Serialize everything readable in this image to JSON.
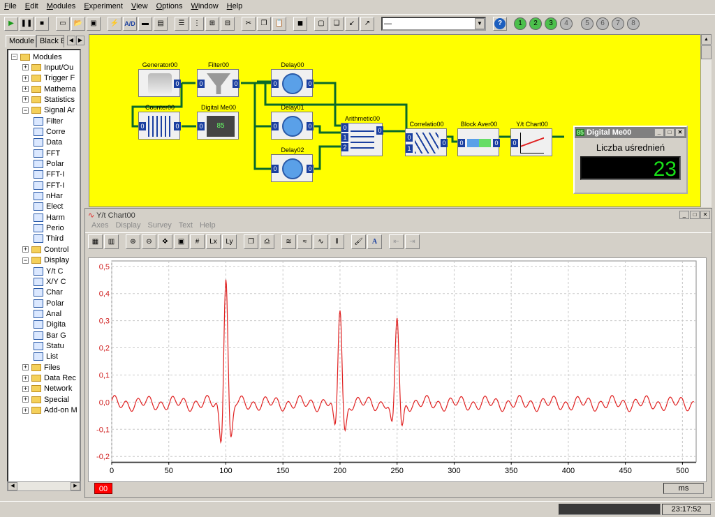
{
  "menu": [
    "File",
    "Edit",
    "Modules",
    "Experiment",
    "View",
    "Options",
    "Window",
    "Help"
  ],
  "toolbar": {
    "combo_value": "—",
    "numbers": [
      "1",
      "2",
      "3",
      "4",
      "5",
      "6",
      "7",
      "8"
    ]
  },
  "left_panel": {
    "tabs": [
      "Module",
      "Black B"
    ],
    "tree": [
      {
        "label": "Modules",
        "level": 0,
        "kind": "folder",
        "toggle": "−"
      },
      {
        "label": "Input/Ou",
        "level": 1,
        "kind": "folder",
        "toggle": "+"
      },
      {
        "label": "Trigger F",
        "level": 1,
        "kind": "folder",
        "toggle": "+"
      },
      {
        "label": "Mathema",
        "level": 1,
        "kind": "folder",
        "toggle": "+"
      },
      {
        "label": "Statistics",
        "level": 1,
        "kind": "folder",
        "toggle": "+"
      },
      {
        "label": "Signal Ar",
        "level": 1,
        "kind": "folder",
        "toggle": "−"
      },
      {
        "label": "Filter",
        "level": 2,
        "kind": "module"
      },
      {
        "label": "Corre",
        "level": 2,
        "kind": "module"
      },
      {
        "label": "Data",
        "level": 2,
        "kind": "module"
      },
      {
        "label": "FFT",
        "level": 2,
        "kind": "module"
      },
      {
        "label": "Polar",
        "level": 2,
        "kind": "module"
      },
      {
        "label": "FFT-I",
        "level": 2,
        "kind": "module"
      },
      {
        "label": "FFT-I",
        "level": 2,
        "kind": "module"
      },
      {
        "label": "nHar",
        "level": 2,
        "kind": "module"
      },
      {
        "label": "Elect",
        "level": 2,
        "kind": "module"
      },
      {
        "label": "Harm",
        "level": 2,
        "kind": "module"
      },
      {
        "label": "Perio",
        "level": 2,
        "kind": "module"
      },
      {
        "label": "Third",
        "level": 2,
        "kind": "module"
      },
      {
        "label": "Control",
        "level": 1,
        "kind": "folder",
        "toggle": "+"
      },
      {
        "label": "Display",
        "level": 1,
        "kind": "folder",
        "toggle": "−"
      },
      {
        "label": "Y/t C",
        "level": 2,
        "kind": "module"
      },
      {
        "label": "X/Y C",
        "level": 2,
        "kind": "module"
      },
      {
        "label": "Char",
        "level": 2,
        "kind": "module"
      },
      {
        "label": "Polar",
        "level": 2,
        "kind": "module"
      },
      {
        "label": "Anal",
        "level": 2,
        "kind": "module"
      },
      {
        "label": "Digita",
        "level": 2,
        "kind": "module"
      },
      {
        "label": "Bar G",
        "level": 2,
        "kind": "module"
      },
      {
        "label": "Statu",
        "level": 2,
        "kind": "module"
      },
      {
        "label": "List",
        "level": 2,
        "kind": "module"
      },
      {
        "label": "Files",
        "level": 1,
        "kind": "folder",
        "toggle": "+"
      },
      {
        "label": "Data Rec",
        "level": 1,
        "kind": "folder",
        "toggle": "+"
      },
      {
        "label": "Network",
        "level": 1,
        "kind": "folder",
        "toggle": "+"
      },
      {
        "label": "Special",
        "level": 1,
        "kind": "folder",
        "toggle": "+"
      },
      {
        "label": "Add-on M",
        "level": 1,
        "kind": "folder",
        "toggle": "+"
      }
    ]
  },
  "workspace": {
    "background": "#ffff00",
    "blocks": [
      {
        "name": "Generator00",
        "inputs": [],
        "outputs": [
          "0"
        ],
        "icon": "generator-icon"
      },
      {
        "name": "Filter00",
        "inputs": [
          "0"
        ],
        "outputs": [
          "0"
        ],
        "icon": "funnel-icon"
      },
      {
        "name": "Delay00",
        "inputs": [
          "0"
        ],
        "outputs": [
          "0"
        ],
        "icon": "clock-icon"
      },
      {
        "name": "Counter00",
        "inputs": [
          "0"
        ],
        "outputs": [
          "0"
        ],
        "icon": "counter-icon"
      },
      {
        "name": "Digital Me00",
        "inputs": [
          "0"
        ],
        "outputs": [],
        "icon": "digital-display-icon",
        "display": "85"
      },
      {
        "name": "Delay01",
        "inputs": [
          "0"
        ],
        "outputs": [
          "0"
        ],
        "icon": "clock-icon"
      },
      {
        "name": "Arithmetic00",
        "inputs": [
          "0",
          "1",
          "2"
        ],
        "outputs": [
          "0"
        ],
        "icon": "abacus-icon"
      },
      {
        "name": "Delay02",
        "inputs": [
          "0"
        ],
        "outputs": [
          "0"
        ],
        "icon": "clock-icon"
      },
      {
        "name": "Correlatio00",
        "inputs": [
          "0",
          "1"
        ],
        "outputs": [
          "0"
        ],
        "icon": "correlation-icon"
      },
      {
        "name": "Block Aver00",
        "inputs": [
          "0"
        ],
        "outputs": [
          "0"
        ],
        "icon": "block-average-icon"
      },
      {
        "name": "Y/t Chart00",
        "inputs": [
          "0"
        ],
        "outputs": [],
        "icon": "chart-icon"
      }
    ]
  },
  "digital_meter": {
    "title": "Digital Me00",
    "badge": "85",
    "label": "Liczba uśrednień",
    "value": "23",
    "value_color": "#18e018"
  },
  "chart_window": {
    "title": "Y/t Chart00",
    "menu": [
      "Axes",
      "Display",
      "Survey",
      "Text",
      "Help"
    ],
    "channel_label": "00",
    "unit": "ms"
  },
  "chart_data": {
    "type": "line",
    "xlabel": "ms",
    "ylabel": "",
    "xlim": [
      0,
      512
    ],
    "ylim": [
      -0.22,
      0.52
    ],
    "xticks": [
      0,
      50,
      100,
      150,
      200,
      250,
      300,
      350,
      400,
      450,
      500
    ],
    "yticks": [
      "0,5",
      "0,4",
      "0,3",
      "0,2",
      "0,1",
      "0,0",
      "-0,1",
      "-0,2"
    ],
    "ytick_values": [
      0.5,
      0.4,
      0.3,
      0.2,
      0.1,
      0.0,
      -0.1,
      -0.2
    ],
    "grid": true,
    "series": [
      {
        "color": "#e02020",
        "peaks": [
          {
            "x": 100,
            "y": 0.48
          },
          {
            "x": 200,
            "y": 0.36
          },
          {
            "x": 250,
            "y": 0.32
          }
        ],
        "x": [
          0,
          10,
          20,
          30,
          40,
          50,
          60,
          70,
          80,
          90,
          95,
          100,
          105,
          110,
          120,
          130,
          140,
          150,
          160,
          170,
          180,
          190,
          195,
          200,
          205,
          210,
          220,
          230,
          240,
          245,
          250,
          255,
          260,
          270,
          280,
          290,
          300,
          310,
          320,
          330,
          340,
          350,
          360,
          370,
          380,
          390,
          400,
          410,
          420,
          430,
          440,
          450,
          460,
          470,
          480,
          490,
          500,
          510
        ],
        "y": [
          -0.02,
          -0.03,
          0.0,
          -0.01,
          0.01,
          -0.02,
          0.0,
          0.02,
          -0.02,
          0.03,
          -0.08,
          0.48,
          -0.09,
          0.05,
          -0.02,
          0.01,
          0.0,
          -0.02,
          0.01,
          -0.03,
          0.02,
          -0.05,
          0.08,
          0.36,
          -0.05,
          0.06,
          -0.03,
          0.01,
          0.04,
          -0.07,
          0.32,
          -0.06,
          0.02,
          -0.03,
          0.02,
          -0.02,
          0.01,
          -0.02,
          0.02,
          -0.01,
          0.02,
          -0.02,
          0.03,
          -0.02,
          0.01,
          -0.03,
          0.02,
          -0.02,
          0.03,
          -0.01,
          0.02,
          -0.02,
          0.03,
          -0.02,
          0.02,
          -0.03,
          0.04,
          -0.02
        ]
      }
    ]
  },
  "status": {
    "time": "23:17:52"
  }
}
